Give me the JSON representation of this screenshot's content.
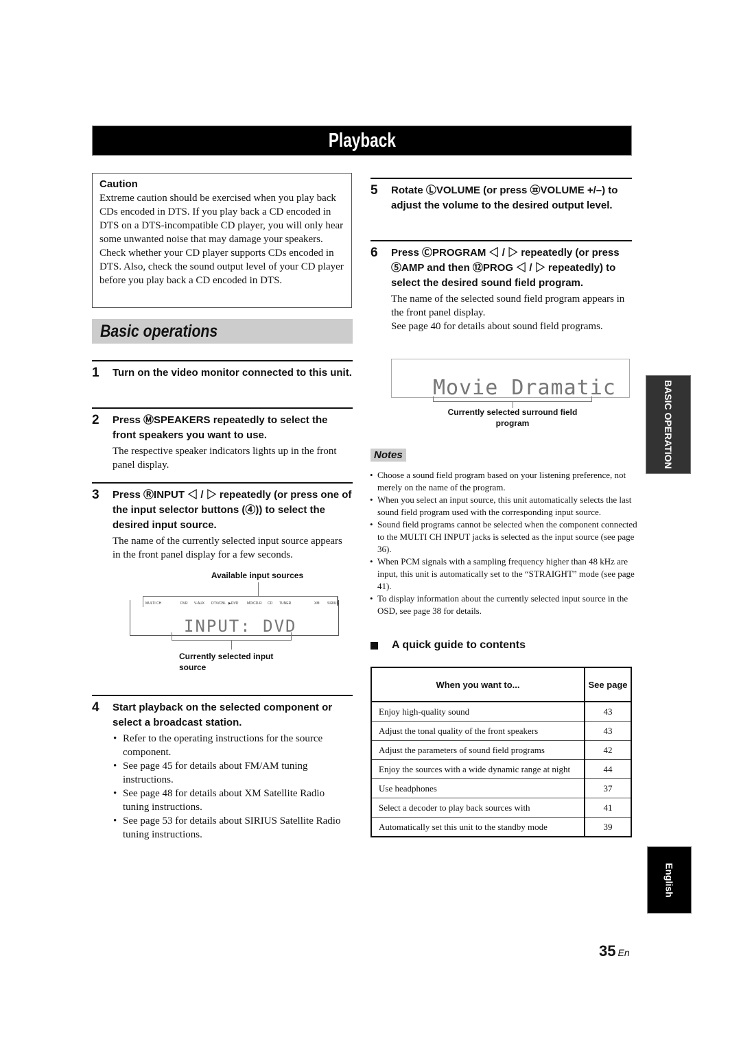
{
  "title": "Playback",
  "caution": {
    "heading": "Caution",
    "body": "Extreme caution should be exercised when you play back CDs encoded in DTS. If you play back a CD encoded in DTS on a DTS-incompatible CD player, you will only hear some unwanted noise that may damage your speakers. Check whether your CD player supports CDs encoded in DTS. Also, check the sound output level of your CD player before you play back a CD encoded in DTS."
  },
  "section_title": "Basic operations",
  "steps": [
    {
      "num": "1",
      "head": "Turn on the video monitor connected to this unit."
    },
    {
      "num": "2",
      "head": "Press ⓂSPEAKERS repeatedly to select the front speakers you want to use.",
      "body": "The respective speaker indicators lights up in the front panel display."
    },
    {
      "num": "3",
      "head": "Press ⓇINPUT ◁ / ▷ repeatedly (or press one of the input selector buttons (④)) to select the desired input source.",
      "body": "The name of the currently selected input source appears in the front panel display for a few seconds."
    },
    {
      "num": "4",
      "head": "Start playback on the selected component or select a broadcast station.",
      "bullets": [
        "Refer to the operating instructions for the source component.",
        "See page 45 for details about FM/AM tuning instructions.",
        "See page 48 for details about XM Satellite Radio tuning instructions.",
        "See page 53 for details about SIRIUS Satellite Radio tuning instructions."
      ]
    },
    {
      "num": "5",
      "head": "Rotate ⓁVOLUME (or press ㉬VOLUME +/–) to adjust the volume to the desired output level."
    },
    {
      "num": "6",
      "head": "Press ⒸPROGRAM ◁ / ▷ repeatedly (or press ⑤AMP and then ⑫PROG ◁ / ▷ repeatedly) to select the desired sound field program.",
      "body": "The name of the selected sound field program appears in the front panel display.",
      "body2": "See page 40 for details about sound field programs."
    }
  ],
  "input_display": {
    "label_top": "Available input sources",
    "sources": [
      "MULTI CH",
      "DVR",
      "V-AUX",
      "DTV/CBL",
      "▶DVD",
      "MD/CD-R",
      "CD",
      "TUNER",
      "XM",
      "SIRIUS"
    ],
    "text": "INPUT: DVD",
    "label_bottom": "Currently selected input source"
  },
  "program_display": {
    "text": "Movie Dramatic",
    "label": "Currently selected surround field program"
  },
  "notes": {
    "label": "Notes",
    "items": [
      "Choose a sound field program based on your listening preference, not merely on the name of the program.",
      "When you select an input source, this unit automatically selects the last sound field program used with the corresponding input source.",
      "Sound field programs cannot be selected when the component connected to the MULTI CH INPUT jacks is selected as the input source (see page 36).",
      "When PCM signals with a sampling frequency higher than 48 kHz are input, this unit is automatically set to the “STRAIGHT” mode (see page 41).",
      "To display information about the currently selected input source in the OSD, see page 38 for details."
    ]
  },
  "quick_guide": {
    "heading": "A quick guide to contents",
    "col_want": "When you want to...",
    "col_page": "See page",
    "rows": [
      {
        "want": "Enjoy high-quality sound",
        "page": "43"
      },
      {
        "want": "Adjust the tonal quality of the front speakers",
        "page": "43"
      },
      {
        "want": "Adjust the parameters of sound field programs",
        "page": "42"
      },
      {
        "want": "Enjoy the sources with a wide dynamic range at night",
        "page": "44"
      },
      {
        "want": "Use headphones",
        "page": "37"
      },
      {
        "want": "Select a decoder to play back sources with",
        "page": "41"
      },
      {
        "want": "Automatically set this unit to the standby mode",
        "page": "39"
      }
    ]
  },
  "side_tabs": {
    "section": "BASIC OPERATION",
    "language": "English"
  },
  "footer": {
    "page": "35",
    "lang": "En"
  }
}
